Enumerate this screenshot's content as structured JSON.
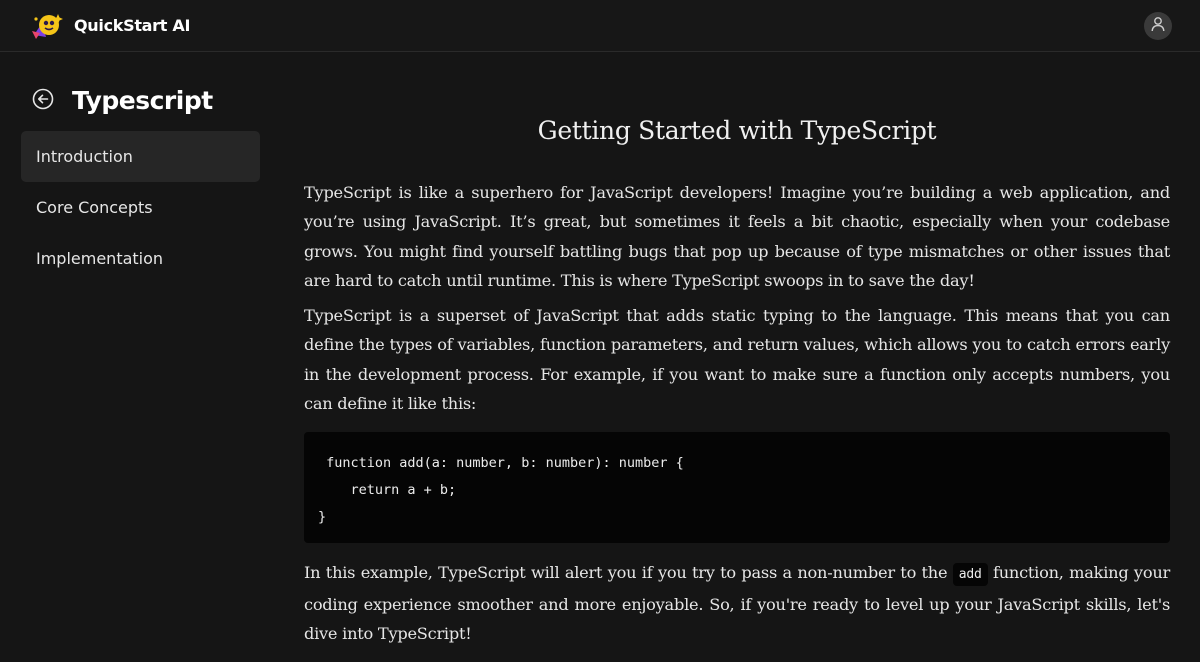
{
  "header": {
    "brand_name": "QuickStart AI",
    "logo_icon": "sparkle-blob-logo",
    "avatar_icon": "user-icon"
  },
  "sidebar": {
    "back_icon": "arrow-left-circle-icon",
    "title": "Typescript",
    "items": [
      {
        "label": "Introduction",
        "active": true
      },
      {
        "label": "Core Concepts",
        "active": false
      },
      {
        "label": "Implementation",
        "active": false
      }
    ]
  },
  "main": {
    "title": "Getting Started with TypeScript",
    "para1": "TypeScript is like a superhero for JavaScript developers! Imagine you’re building a web application, and you’re using JavaScript. It’s great, but sometimes it feels a bit chaotic, especially when your codebase grows. You might find yourself battling bugs that pop up because of type mismatches or other issues that are hard to catch until runtime. This is where TypeScript swoops in to save the day!",
    "para2": "TypeScript is a superset of JavaScript that adds static typing to the language. This means that you can define the types of variables, function parameters, and return values, which allows you to catch errors early in the development process. For example, if you want to make sure a function only accepts numbers, you can define it like this:",
    "code": [
      " function add(a: number, b: number): number {",
      "    return a + b;",
      "}"
    ],
    "para3_before": "In this example, TypeScript will alert you if you try to pass a non-number to the ",
    "para3_code": "add",
    "para3_after": " function, making your coding experience smoother and more enjoyable. So, if you're ready to level up your JavaScript skills, let's dive into TypeScript!"
  },
  "colors": {
    "background": "#151515",
    "header_bg": "#171717",
    "active_item_bg": "#262626",
    "code_bg": "#050505",
    "logo_yellow": "#f5c518",
    "logo_purple": "#7b3fe4"
  }
}
